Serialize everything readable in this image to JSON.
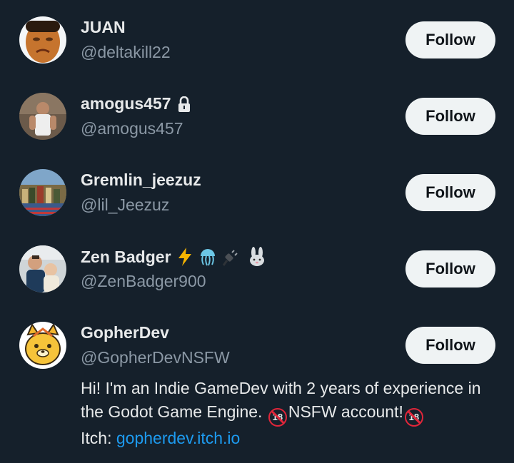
{
  "users": [
    {
      "name": "JUAN",
      "handle": "@deltakill22",
      "follow_label": "Follow"
    },
    {
      "name": "amogus457",
      "handle": "@amogus457",
      "follow_label": "Follow"
    },
    {
      "name": "Gremlin_jeezuz",
      "handle": "@lil_Jeezuz",
      "follow_label": "Follow"
    },
    {
      "name": "Zen Badger",
      "handle": "@ZenBadger900",
      "follow_label": "Follow"
    },
    {
      "name": "GopherDev",
      "handle": "@GopherDevNSFW",
      "follow_label": "Follow"
    }
  ],
  "bio": {
    "part1": "Hi! I'm an Indie GameDev with 2 years of experience in the Godot Game Engine. ",
    "badge": "18",
    "part2": "NSFW account!",
    "itch_label": "Itch: ",
    "link": "gopherdev.itch.io"
  },
  "icons": {
    "protected": "lock-icon",
    "zen_badger_emojis": [
      "lightning-icon",
      "jellyfish-icon",
      "plug-icon",
      "rabbit-icon"
    ]
  },
  "colors": {
    "background": "#15202b",
    "text_primary": "#e7e9ea",
    "text_secondary": "#8b98a5",
    "button_bg": "#eff3f4",
    "link": "#1d9bf0"
  }
}
